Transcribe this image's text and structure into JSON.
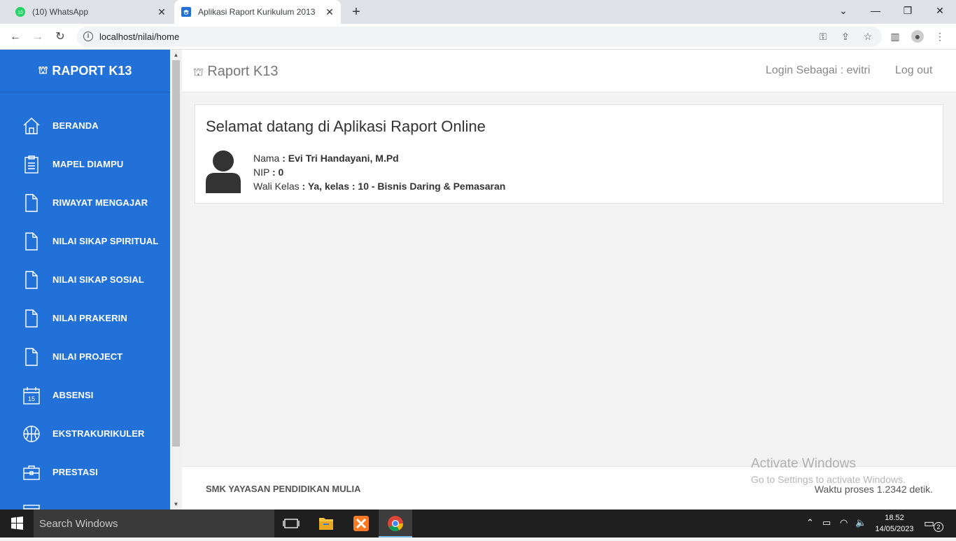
{
  "browser": {
    "tabs": [
      {
        "title": "(10) WhatsApp",
        "badge": "10"
      },
      {
        "title": "Aplikasi Raport Kurikulum 2013"
      }
    ],
    "url": "localhost/nilai/home"
  },
  "sidebar": {
    "brand": "RAPORT K13",
    "items": [
      {
        "label": "BERANDA",
        "icon": "home-icon"
      },
      {
        "label": "MAPEL DIAMPU",
        "icon": "clipboard-icon"
      },
      {
        "label": "RIWAYAT MENGAJAR",
        "icon": "document-icon"
      },
      {
        "label": "NILAI SIKAP SPIRITUAL",
        "icon": "document-icon"
      },
      {
        "label": "NILAI SIKAP SOSIAL",
        "icon": "document-icon"
      },
      {
        "label": "NILAI PRAKERIN",
        "icon": "document-icon"
      },
      {
        "label": "NILAI PROJECT",
        "icon": "document-icon"
      },
      {
        "label": "ABSENSI",
        "icon": "calendar-icon",
        "icon_text": "15"
      },
      {
        "label": "EKSTRAKURIKULER",
        "icon": "ball-icon"
      },
      {
        "label": "PRESTASI",
        "icon": "briefcase-icon"
      }
    ]
  },
  "header": {
    "title": "Raport K13",
    "login_label": "Login Sebagai : evitri",
    "logout_label": "Log out"
  },
  "welcome": {
    "heading": "Selamat datang di Aplikasi Raport Online",
    "nama_label": "Nama",
    "nama_value": ": Evi Tri Handayani, M.Pd",
    "nip_label": "NIP",
    "nip_value": ": 0",
    "wali_label": "Wali Kelas",
    "wali_value": ": Ya, kelas : 10 - Bisnis Daring & Pemasaran"
  },
  "footer": {
    "school": "SMK YAYASAN PENDIDIKAN MULIA",
    "process_time": "Waktu proses 1.2342 detik."
  },
  "watermark": {
    "line1": "Activate Windows",
    "line2": "Go to Settings to activate Windows."
  },
  "taskbar": {
    "search_placeholder": "Search Windows",
    "time": "18.52",
    "date": "14/05/2023",
    "notification_count": "2"
  },
  "colors": {
    "sidebar": "#2271d9",
    "accent": "#1a73e8"
  }
}
